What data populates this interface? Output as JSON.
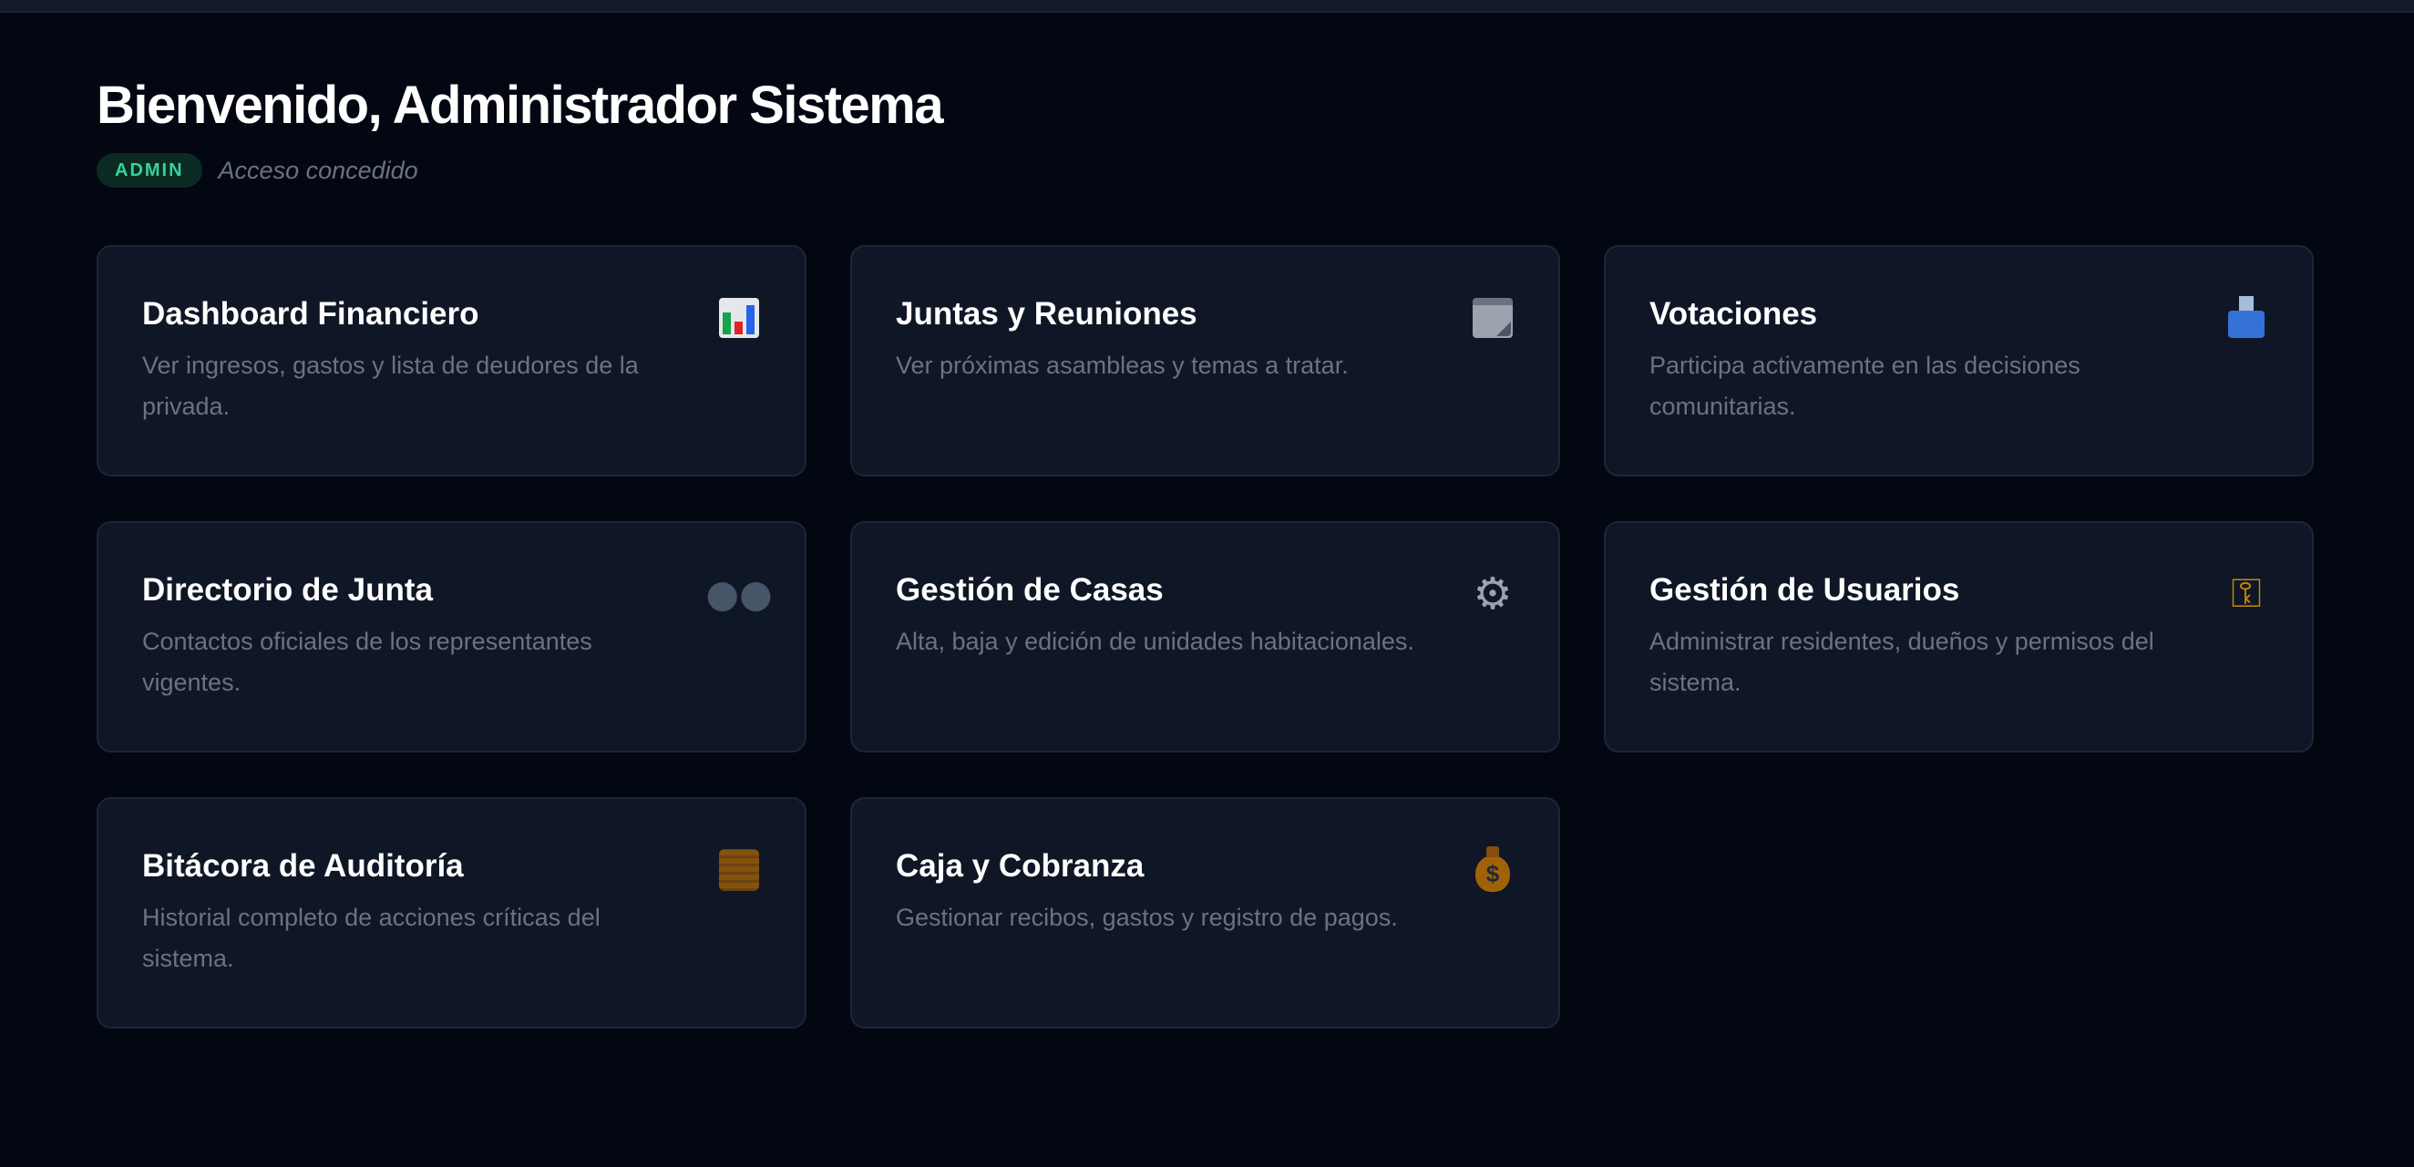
{
  "header": {
    "title": "Bienvenido, Administrador Sistema",
    "role_badge": "ADMIN",
    "status": "Acceso concedido"
  },
  "colors": {
    "background": "#030712",
    "card": "#0f1726",
    "badge_text": "#34d399",
    "muted_text": "#6b7280"
  },
  "cards": [
    {
      "title": "Dashboard Financiero",
      "description": "Ver ingresos, gastos y lista de deudores de la privada.",
      "icon": "bar-chart-icon"
    },
    {
      "title": "Juntas y Reuniones",
      "description": "Ver próximas asambleas y temas a tratar.",
      "icon": "notepad-icon"
    },
    {
      "title": "Votaciones",
      "description": "Participa activamente en las decisiones comunitarias.",
      "icon": "ballot-box-icon"
    },
    {
      "title": "Directorio de Junta",
      "description": "Contactos oficiales de los representantes vigentes.",
      "icon": "people-icon"
    },
    {
      "title": "Gestión de Casas",
      "description": "Alta, baja y edición de unidades habitacionales.",
      "icon": "gear-icon"
    },
    {
      "title": "Gestión de Usuarios",
      "description": "Administrar residentes, dueños y permisos del sistema.",
      "icon": "key-icon"
    },
    {
      "title": "Bitácora de Auditoría",
      "description": "Historial completo de acciones críticas del sistema.",
      "icon": "scroll-icon"
    },
    {
      "title": "Caja y Cobranza",
      "description": "Gestionar recibos, gastos y registro de pagos.",
      "icon": "money-bag-icon"
    }
  ]
}
